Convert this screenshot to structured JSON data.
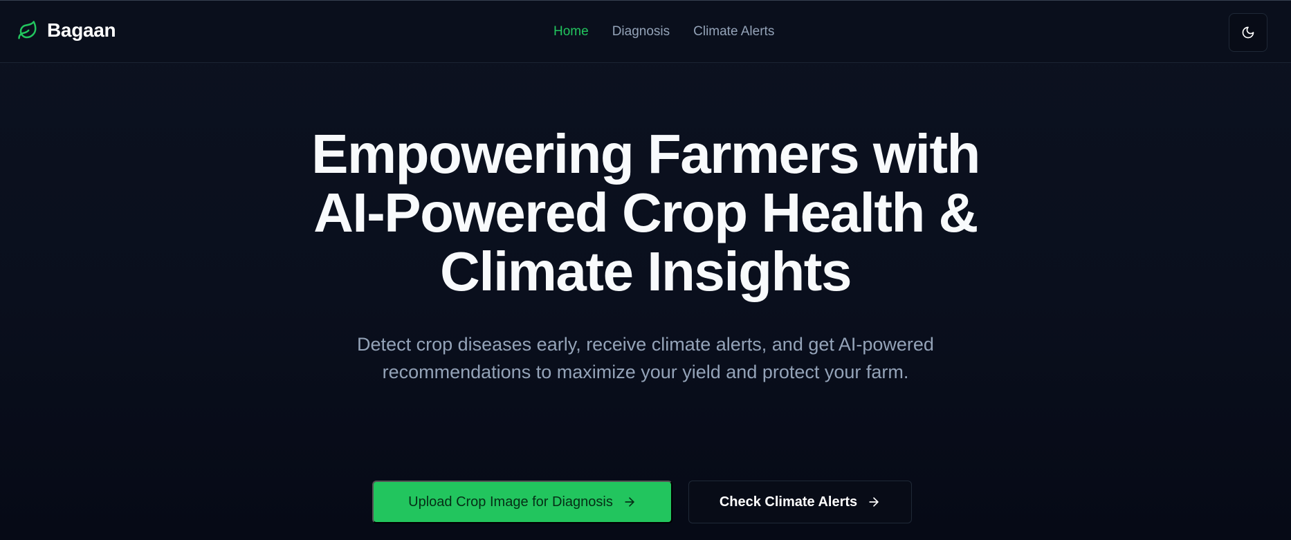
{
  "brand": {
    "name": "Bagaan",
    "icon": "leaf-icon",
    "accent_color": "#22c55e"
  },
  "nav": {
    "items": [
      {
        "label": "Home",
        "active": true
      },
      {
        "label": "Diagnosis",
        "active": false
      },
      {
        "label": "Climate Alerts",
        "active": false
      }
    ]
  },
  "theme_toggle": {
    "icon": "moon-icon"
  },
  "hero": {
    "title_lines": [
      "Empowering Farmers with",
      "AI-Powered Crop Health &",
      "Climate Insights"
    ],
    "subtitle_lines": [
      "Detect crop diseases early, receive climate alerts, and get AI-powered",
      "recommendations to maximize your yield and protect your farm."
    ],
    "primary_button": {
      "label": "Upload Crop Image for Diagnosis",
      "icon": "arrow-right-icon",
      "color": "#22c55e"
    },
    "secondary_button": {
      "label": "Check Climate Alerts",
      "icon": "arrow-right-icon"
    }
  }
}
